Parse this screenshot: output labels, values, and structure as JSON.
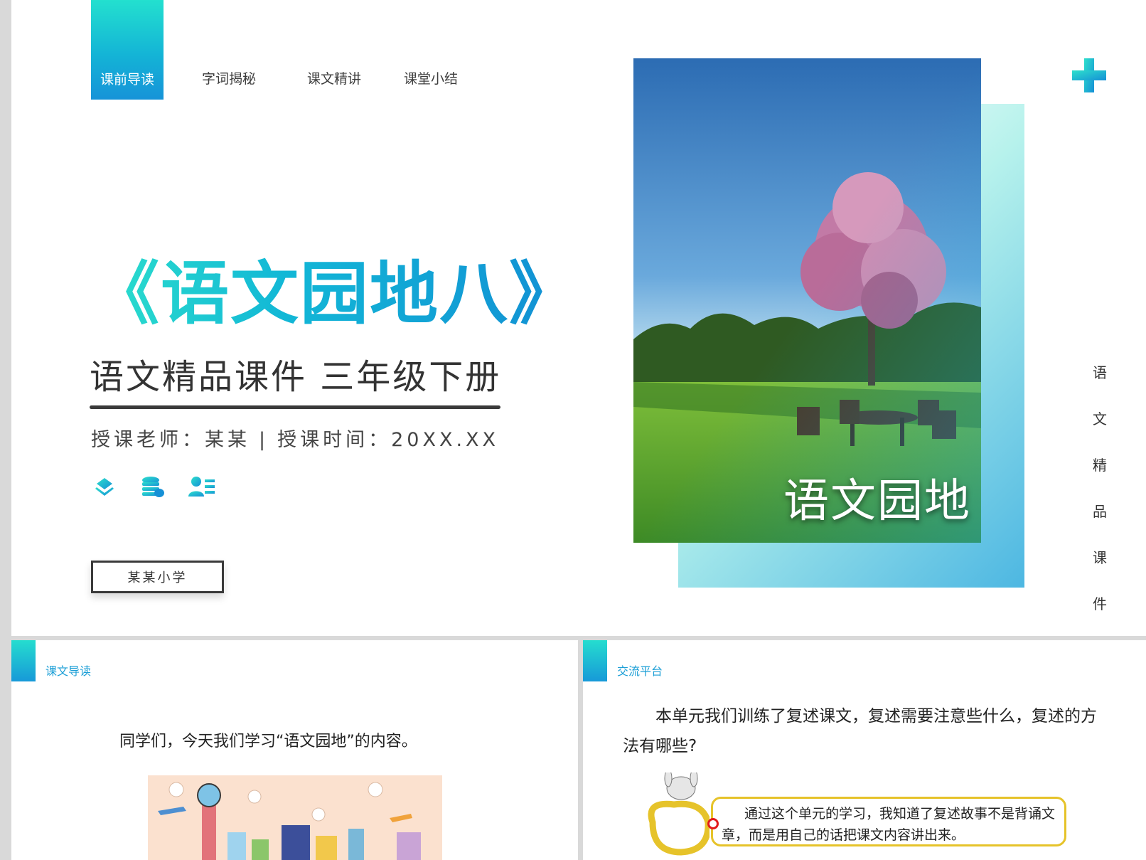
{
  "nav": {
    "items": [
      {
        "label": "课前导读"
      },
      {
        "label": "字词揭秘"
      },
      {
        "label": "课文精讲"
      },
      {
        "label": "课堂小结"
      }
    ]
  },
  "cover": {
    "title": "《语文园地八》",
    "subtitle": "语文精品课件  三年级下册",
    "teacher_label": "授课老师：",
    "teacher_name": "某某",
    "separator": "|",
    "time_label": "授课时间：",
    "time_value": "20XX.XX",
    "school": "某某小学",
    "photo_caption": "语文园地",
    "vertical_chars": [
      "语",
      "文",
      "精",
      "品",
      "课",
      "件"
    ],
    "icons": [
      "layers-icon",
      "coins-stack-icon",
      "user-list-icon"
    ],
    "accent_colors": {
      "teal": "#23e0cf",
      "blue": "#1693d8"
    }
  },
  "slide_left": {
    "tag": "课文导读",
    "text": "同学们，今天我们学习“语文园地”的内容。"
  },
  "slide_right": {
    "tag": "交流平台",
    "question": "本单元我们训练了复述课文，复述需要注意些什么，复述的方法有哪些?",
    "bubble": "通过这个单元的学习，我知道了复述故事不是背诵文章，而是用自己的话把课文内容讲出来。"
  }
}
